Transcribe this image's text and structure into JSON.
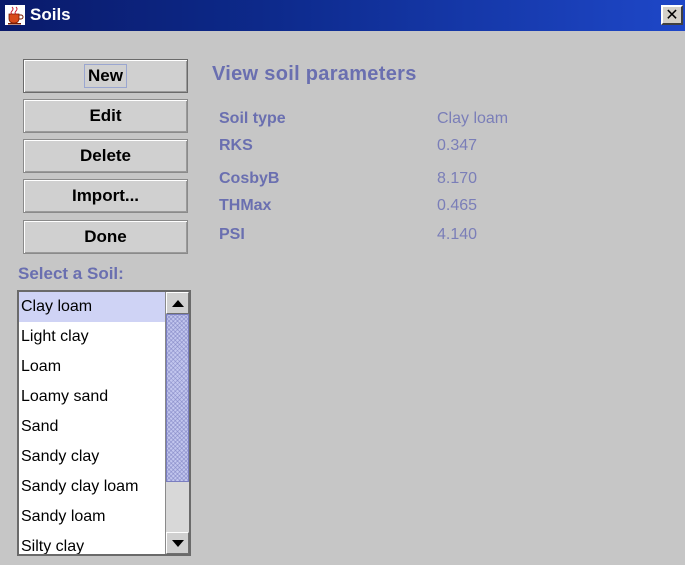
{
  "window": {
    "title": "Soils",
    "close_glyph": "✕",
    "icon": "java-cup-icon"
  },
  "commands": {
    "new": "New",
    "edit": "Edit",
    "delete": "Delete",
    "import": "Import...",
    "done": "Done"
  },
  "select_label": "Select a Soil:",
  "soil_list": {
    "items": [
      "Clay loam",
      "Light clay",
      "Loam",
      "Loamy sand",
      "Sand",
      "Sandy clay",
      "Sandy clay loam",
      "Sandy loam",
      "Silty clay"
    ],
    "selected": "Clay loam"
  },
  "view": {
    "heading": "View soil parameters",
    "params": [
      {
        "name": "Soil type",
        "value": "Clay loam"
      },
      {
        "name": "RKS",
        "value": "0.347"
      },
      {
        "name": "CosbyB",
        "value": "8.170"
      },
      {
        "name": "THMax",
        "value": "0.465"
      },
      {
        "name": "PSI",
        "value": "4.140"
      }
    ]
  },
  "colors": {
    "label_accent": "#6a6fb0",
    "selection": "#cfd3f5",
    "title_bar": "#0d2a8c"
  }
}
